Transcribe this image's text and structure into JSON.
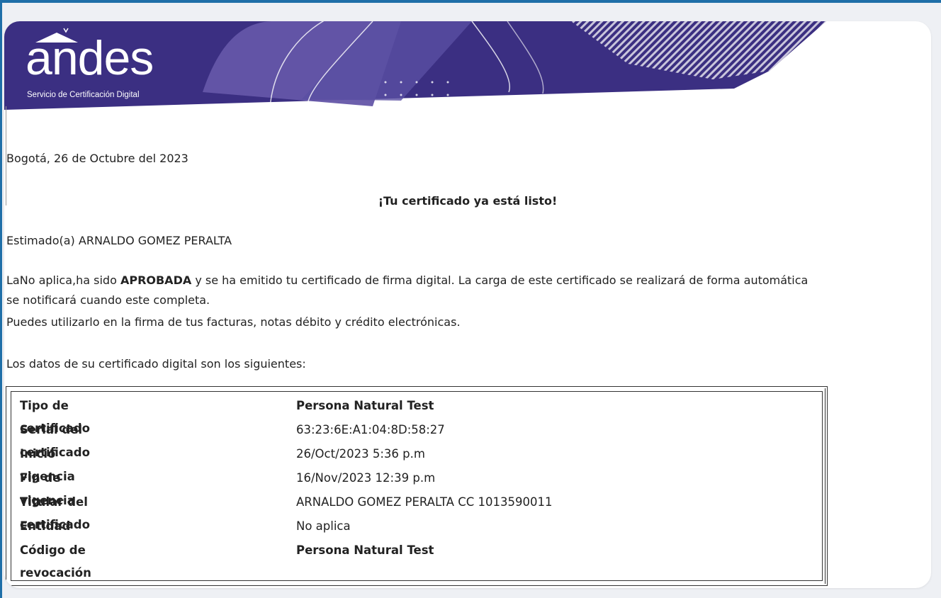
{
  "brand": {
    "logo_text": "andes",
    "tagline": "Servicio de Certificación Digital",
    "colors": {
      "banner_dark": "#3b2f82",
      "banner_mid": "#5a4fa3",
      "banner_light": "#7b70b8",
      "frame": "#1f6fa8"
    }
  },
  "letter": {
    "date_line": "Bogotá, 26 de Octubre del 2023",
    "headline": "¡Tu certificado ya está listo!",
    "greeting": "Estimado(a) ARNALDO GOMEZ PERALTA",
    "body_prefix": "LaNo aplica,ha sido ",
    "body_bold": "APROBADA",
    "body_suffix": " y se ha emitido tu certificado de firma digital. La carga de este certificado se realizará de forma automática",
    "body_line2": "se notificará cuando este completa.",
    "body_line3": "Puedes utilizarlo en la firma de tus facturas, notas débito y crédito electrónicas.",
    "table_intro": "Los datos de su certificado digital son los siguientes:"
  },
  "certificate_table": [
    {
      "label": "Tipo de certificado",
      "value": "Persona Natural Test"
    },
    {
      "label": "Serial del certificado",
      "value": "63:23:6E:A1:04:8D:58:27"
    },
    {
      "label": "Inicio vigencia",
      "value": "26/Oct/2023 5:36 p.m"
    },
    {
      "label": "Fin de vigencia",
      "value": "16/Nov/2023 12:39 p.m"
    },
    {
      "label": "Titular del certificado",
      "value": "ARNALDO GOMEZ PERALTA  CC 1013590011"
    },
    {
      "label": "Entidad",
      "value": "No aplica"
    },
    {
      "label": "Código de revocación",
      "value": "Persona Natural Test"
    }
  ]
}
